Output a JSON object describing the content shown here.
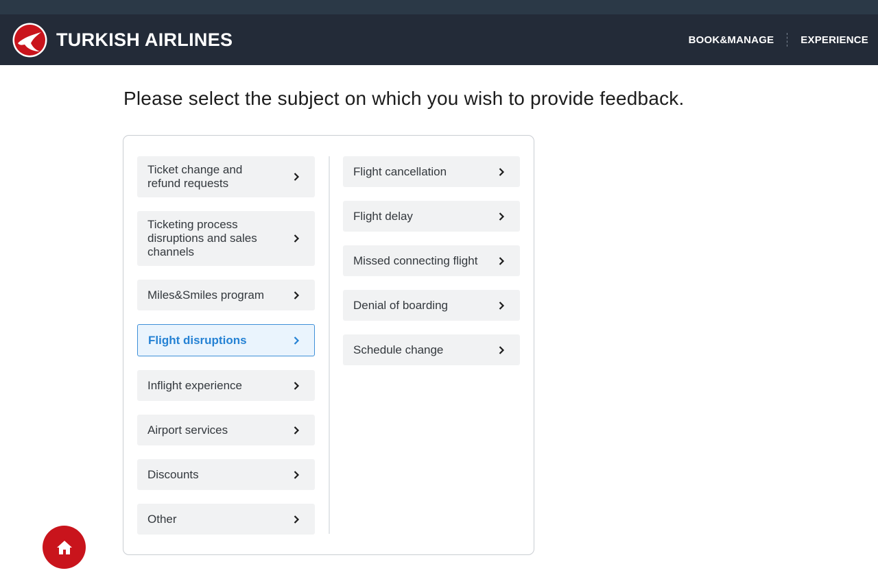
{
  "header": {
    "brand": "TURKISH AIRLINES",
    "nav": [
      "BOOK&MANAGE",
      "EXPERIENCE"
    ],
    "brand_color": "#c9141c",
    "bg_color": "#232b38"
  },
  "page": {
    "title": "Please select the subject on which you wish to provide feedback."
  },
  "categories": {
    "left": [
      {
        "label": "Ticket change and refund requests",
        "selected": false
      },
      {
        "label": "Ticketing process disruptions and sales channels",
        "selected": false
      },
      {
        "label": "Miles&Smiles program",
        "selected": false
      },
      {
        "label": "Flight disruptions",
        "selected": true
      },
      {
        "label": "Inflight experience",
        "selected": false
      },
      {
        "label": "Airport services",
        "selected": false
      },
      {
        "label": "Discounts",
        "selected": false
      },
      {
        "label": "Other",
        "selected": false
      }
    ],
    "right": [
      {
        "label": "Flight cancellation"
      },
      {
        "label": "Flight delay"
      },
      {
        "label": "Missed connecting flight"
      },
      {
        "label": "Denial of boarding"
      },
      {
        "label": "Schedule change"
      }
    ],
    "selected_color": "#2582d4"
  },
  "icons": {
    "logo": "turkish-airlines-crane-icon",
    "chevron": "chevron-right-icon",
    "home": "home-icon"
  }
}
